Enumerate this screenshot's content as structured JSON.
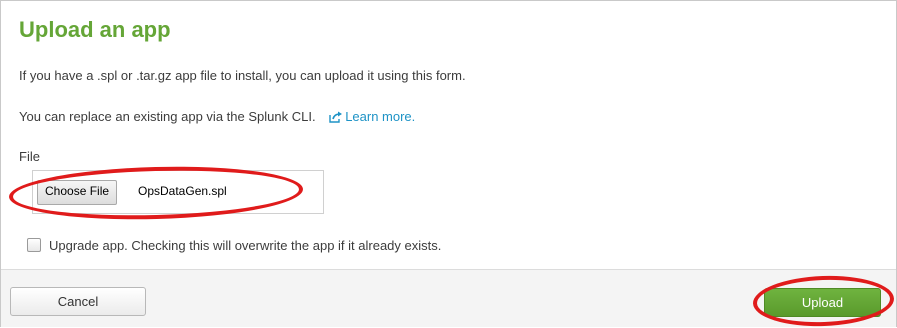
{
  "dialog": {
    "title": "Upload an app",
    "description": "If you have a .spl or .tar.gz app file to install, you can upload it using this form.",
    "replace_text": "You can replace an existing app via the Splunk CLI.",
    "learn_more_label": "Learn more.",
    "learn_more_icon": "external-link-icon"
  },
  "file_field": {
    "label": "File",
    "choose_button_label": "Choose File",
    "selected_file": "OpsDataGen.spl"
  },
  "upgrade": {
    "label": "Upgrade app. Checking this will overwrite the app if it already exists.",
    "checked": false
  },
  "footer": {
    "cancel_label": "Cancel",
    "upload_label": "Upload"
  },
  "colors": {
    "title": "#65a637",
    "link": "#1e93c6",
    "upload_button": "#65a637",
    "annotation": "#e01b1b"
  }
}
